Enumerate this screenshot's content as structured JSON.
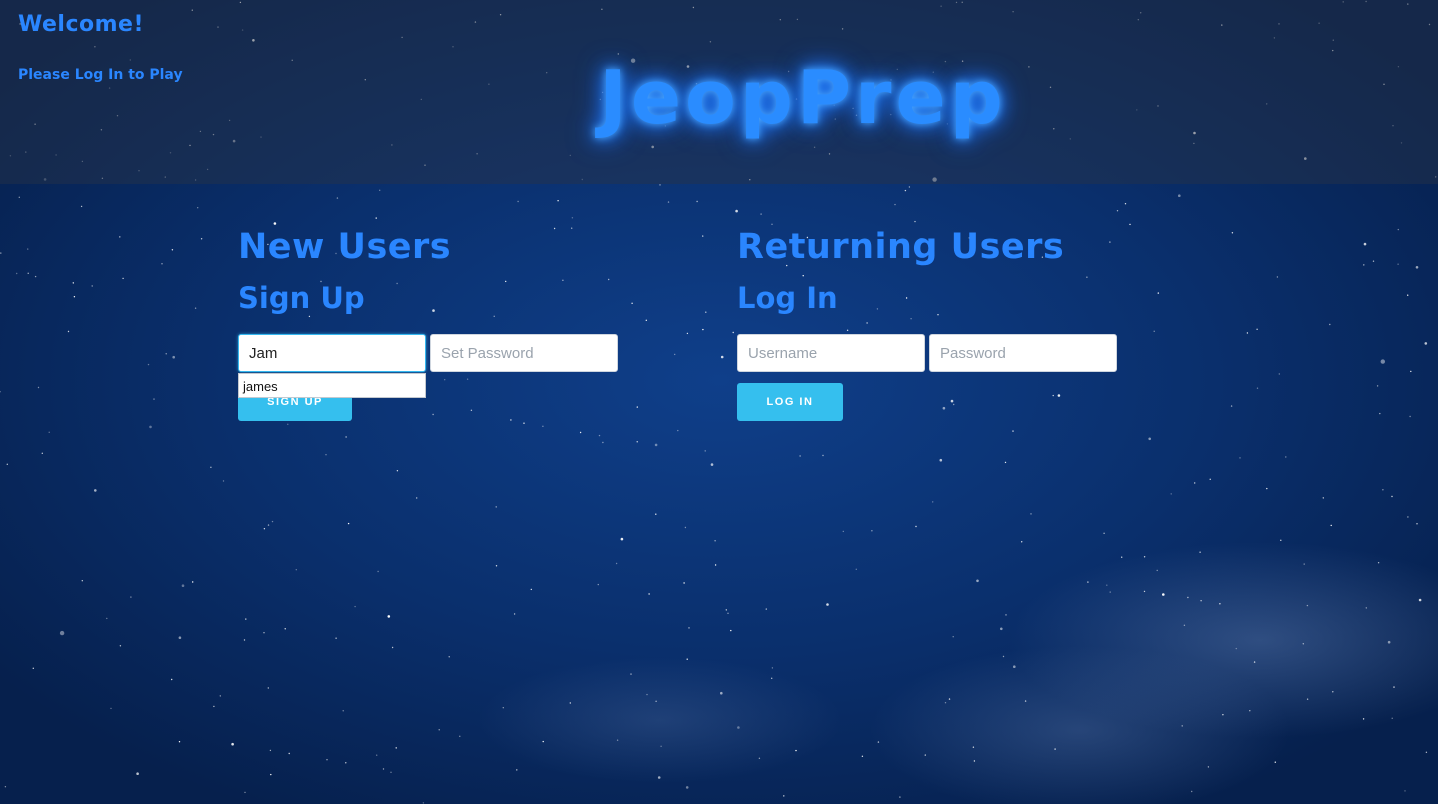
{
  "header": {
    "welcome": "Welcome!",
    "login_prompt": "Please Log In to Play",
    "logo": "JeopPrep"
  },
  "new_users": {
    "title": "New Users",
    "subtitle": "Sign Up",
    "username_value": "Jam",
    "password_placeholder": "Set Password",
    "autocomplete_suggestion": "james",
    "button_label": "SIGN UP"
  },
  "returning_users": {
    "title": "Returning Users",
    "subtitle": "Log In",
    "username_placeholder": "Username",
    "password_placeholder": "Password",
    "button_label": "LOG IN"
  },
  "colors": {
    "accent_text": "#2a86ff",
    "button": "#35bfee",
    "background": "#0a2f6c"
  }
}
